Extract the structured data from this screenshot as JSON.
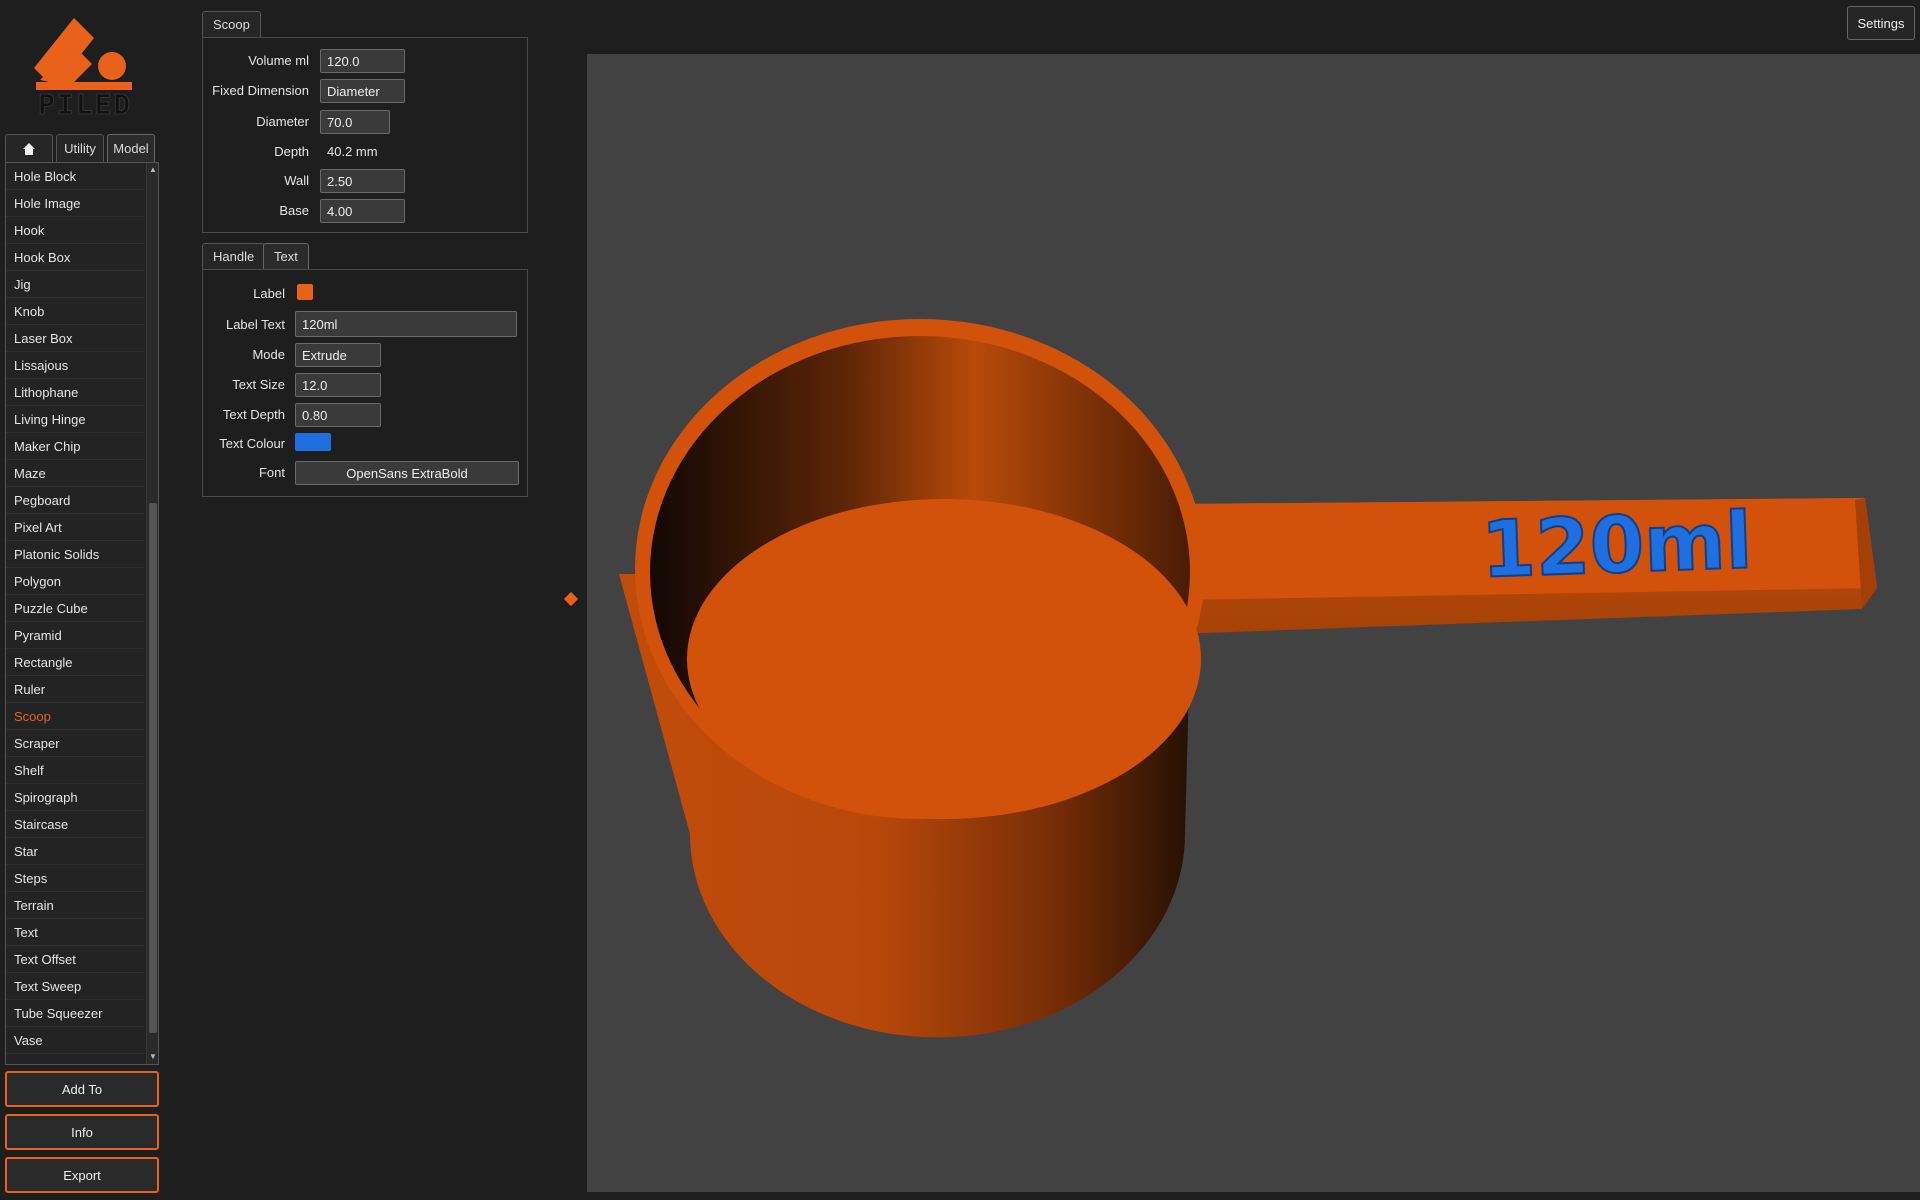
{
  "logo": {
    "text": "PILED"
  },
  "left_tabs": [
    {
      "icon": "home-icon",
      "label": ""
    },
    {
      "label": "Utility"
    },
    {
      "label": "Model"
    }
  ],
  "model_list": {
    "items": [
      "Hole Block",
      "Hole Image",
      "Hook",
      "Hook Box",
      "Jig",
      "Knob",
      "Laser Box",
      "Lissajous",
      "Lithophane",
      "Living Hinge",
      "Maker Chip",
      "Maze",
      "Pegboard",
      "Pixel Art",
      "Platonic Solids",
      "Polygon",
      "Puzzle Cube",
      "Pyramid",
      "Rectangle",
      "Ruler",
      "Scoop",
      "Scraper",
      "Shelf",
      "Spirograph",
      "Staircase",
      "Star",
      "Steps",
      "Terrain",
      "Text",
      "Text Offset",
      "Text Sweep",
      "Tube Squeezer",
      "Vase"
    ],
    "selected": "Scoop"
  },
  "buttons": {
    "add_to": "Add To",
    "info": "Info",
    "export": "Export",
    "settings": "Settings"
  },
  "scoop_panel": {
    "tab": "Scoop",
    "volume_label": "Volume ml",
    "volume": "120.0",
    "fixed_dimension_label": "Fixed Dimension",
    "fixed_dimension": "Diameter",
    "diameter_label": "Diameter",
    "diameter": "70.0",
    "depth_label": "Depth",
    "depth": "40.2 mm",
    "wall_label": "Wall",
    "wall": "2.50",
    "base_label": "Base",
    "base": "4.00"
  },
  "text_panel": {
    "tabs": [
      "Handle",
      "Text"
    ],
    "active_tab": "Text",
    "label_label": "Label",
    "label_color": "#e8621c",
    "label_text_label": "Label Text",
    "label_text": "120ml",
    "mode_label": "Mode",
    "mode": "Extrude",
    "text_size_label": "Text Size",
    "text_size": "12.0",
    "text_depth_label": "Text Depth",
    "text_depth": "0.80",
    "text_colour_label": "Text Colour",
    "text_colour": "#1f6fe0",
    "font_label": "Font",
    "font": "OpenSans ExtraBold"
  },
  "viewport": {
    "model_color": "#d2520c",
    "embossed_text": "120ml",
    "embossed_color": "#1f6fe0"
  },
  "colors": {
    "accent": "#e8621c",
    "background": "#1e1e1e",
    "viewport": "#424242"
  }
}
